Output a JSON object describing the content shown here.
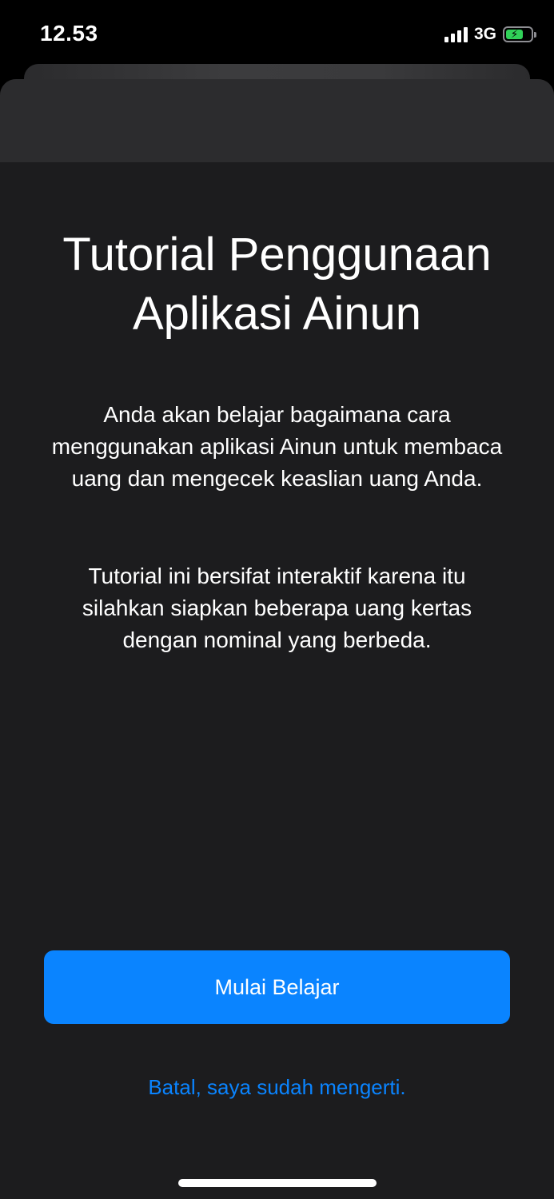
{
  "status_bar": {
    "time": "12.53",
    "network": "3G",
    "battery_color": "#30d158",
    "signal_icon": "cellular-signal-icon",
    "battery_icon": "battery-charging-icon",
    "battery_level": 0.7
  },
  "sheet": {
    "title_line1": "Tutorial Penggunaan",
    "title_line2": "Aplikasi Ainun",
    "paragraph1": "Anda akan belajar bagaimana cara menggunakan aplikasi Ainun untuk membaca uang dan mengecek keaslian uang Anda.",
    "paragraph2": "Tutorial ini bersifat interaktif karena itu silahkan siapkan beberapa uang kertas dengan nominal yang berbeda.",
    "primary_button_label": "Mulai Belajar",
    "secondary_link_label": "Batal, saya sudah mengerti."
  },
  "colors": {
    "accent": "#0a84ff",
    "background": "#1c1c1e"
  }
}
